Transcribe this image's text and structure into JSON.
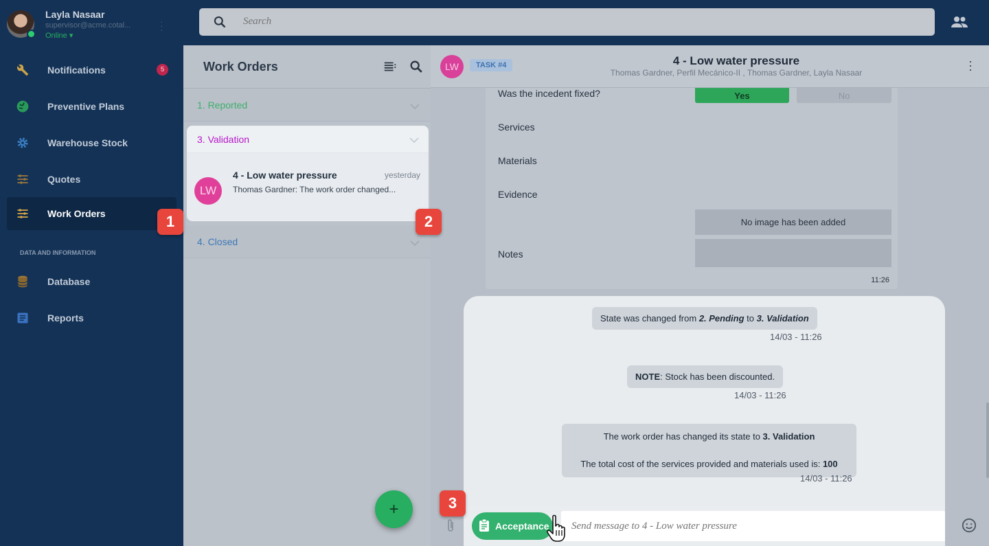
{
  "user": {
    "name": "Layla Nasaar",
    "email": "supervisor@acme.cotal...",
    "status": "Online ▾"
  },
  "sidebar": {
    "items": [
      {
        "label": "Notifications",
        "badge": "5"
      },
      {
        "label": "Preventive Plans"
      },
      {
        "label": "Warehouse Stock"
      },
      {
        "label": "Quotes"
      },
      {
        "label": "Work Orders",
        "active": true
      }
    ],
    "section_label": "DATA AND INFORMATION",
    "data_items": [
      {
        "label": "Database"
      },
      {
        "label": "Reports"
      }
    ]
  },
  "search": {
    "placeholder": "Search"
  },
  "list": {
    "title": "Work Orders",
    "groups": {
      "reported": "1. Reported",
      "validation": "3. Validation",
      "closed": "4. Closed"
    },
    "work_order": {
      "avatar": "LW",
      "title": "4 - Low water pressure",
      "time": "yesterday",
      "preview": "Thomas Gardner: The work order changed..."
    },
    "fab_label": "+"
  },
  "chat": {
    "avatar": "LW",
    "task_tag": "TASK #4",
    "title": "4 - Low water pressure",
    "members": "Thomas Gardner, Perfil Mecánico-II , Thomas Gardner, Layla Nasaar",
    "form": {
      "fixed_label": "Was the incedent fixed?",
      "yes": "Yes",
      "no": "No",
      "services": "Services",
      "materials": "Materials",
      "evidence": "Evidence",
      "evidence_value": "No image has been added",
      "notes": "Notes",
      "time": "11:26"
    },
    "messages": [
      {
        "pre": "State was changed from ",
        "b1": "2. Pending",
        "mid": " to ",
        "b2": "3. Validation",
        "time": "14/03 - 11:26"
      },
      {
        "b1": "NOTE",
        "rest": ": Stock has been discounted.",
        "time": "14/03 - 11:26"
      },
      {
        "line1": "The work order has changed its state to ",
        "b1": "3. Validation",
        "line2": "The total cost of the services provided and materials used is: ",
        "b2": "100",
        "time": "14/03 - 11:26"
      }
    ],
    "composer": {
      "button": "Acceptance",
      "placeholder": "Send message to 4 - Low water pressure"
    }
  },
  "markers": [
    "1",
    "2",
    "3"
  ],
  "colors": {
    "sidebar": "#143256",
    "accent_green": "#27ae60",
    "validation_purple": "#b517c9",
    "marker_red": "#e8453c"
  }
}
